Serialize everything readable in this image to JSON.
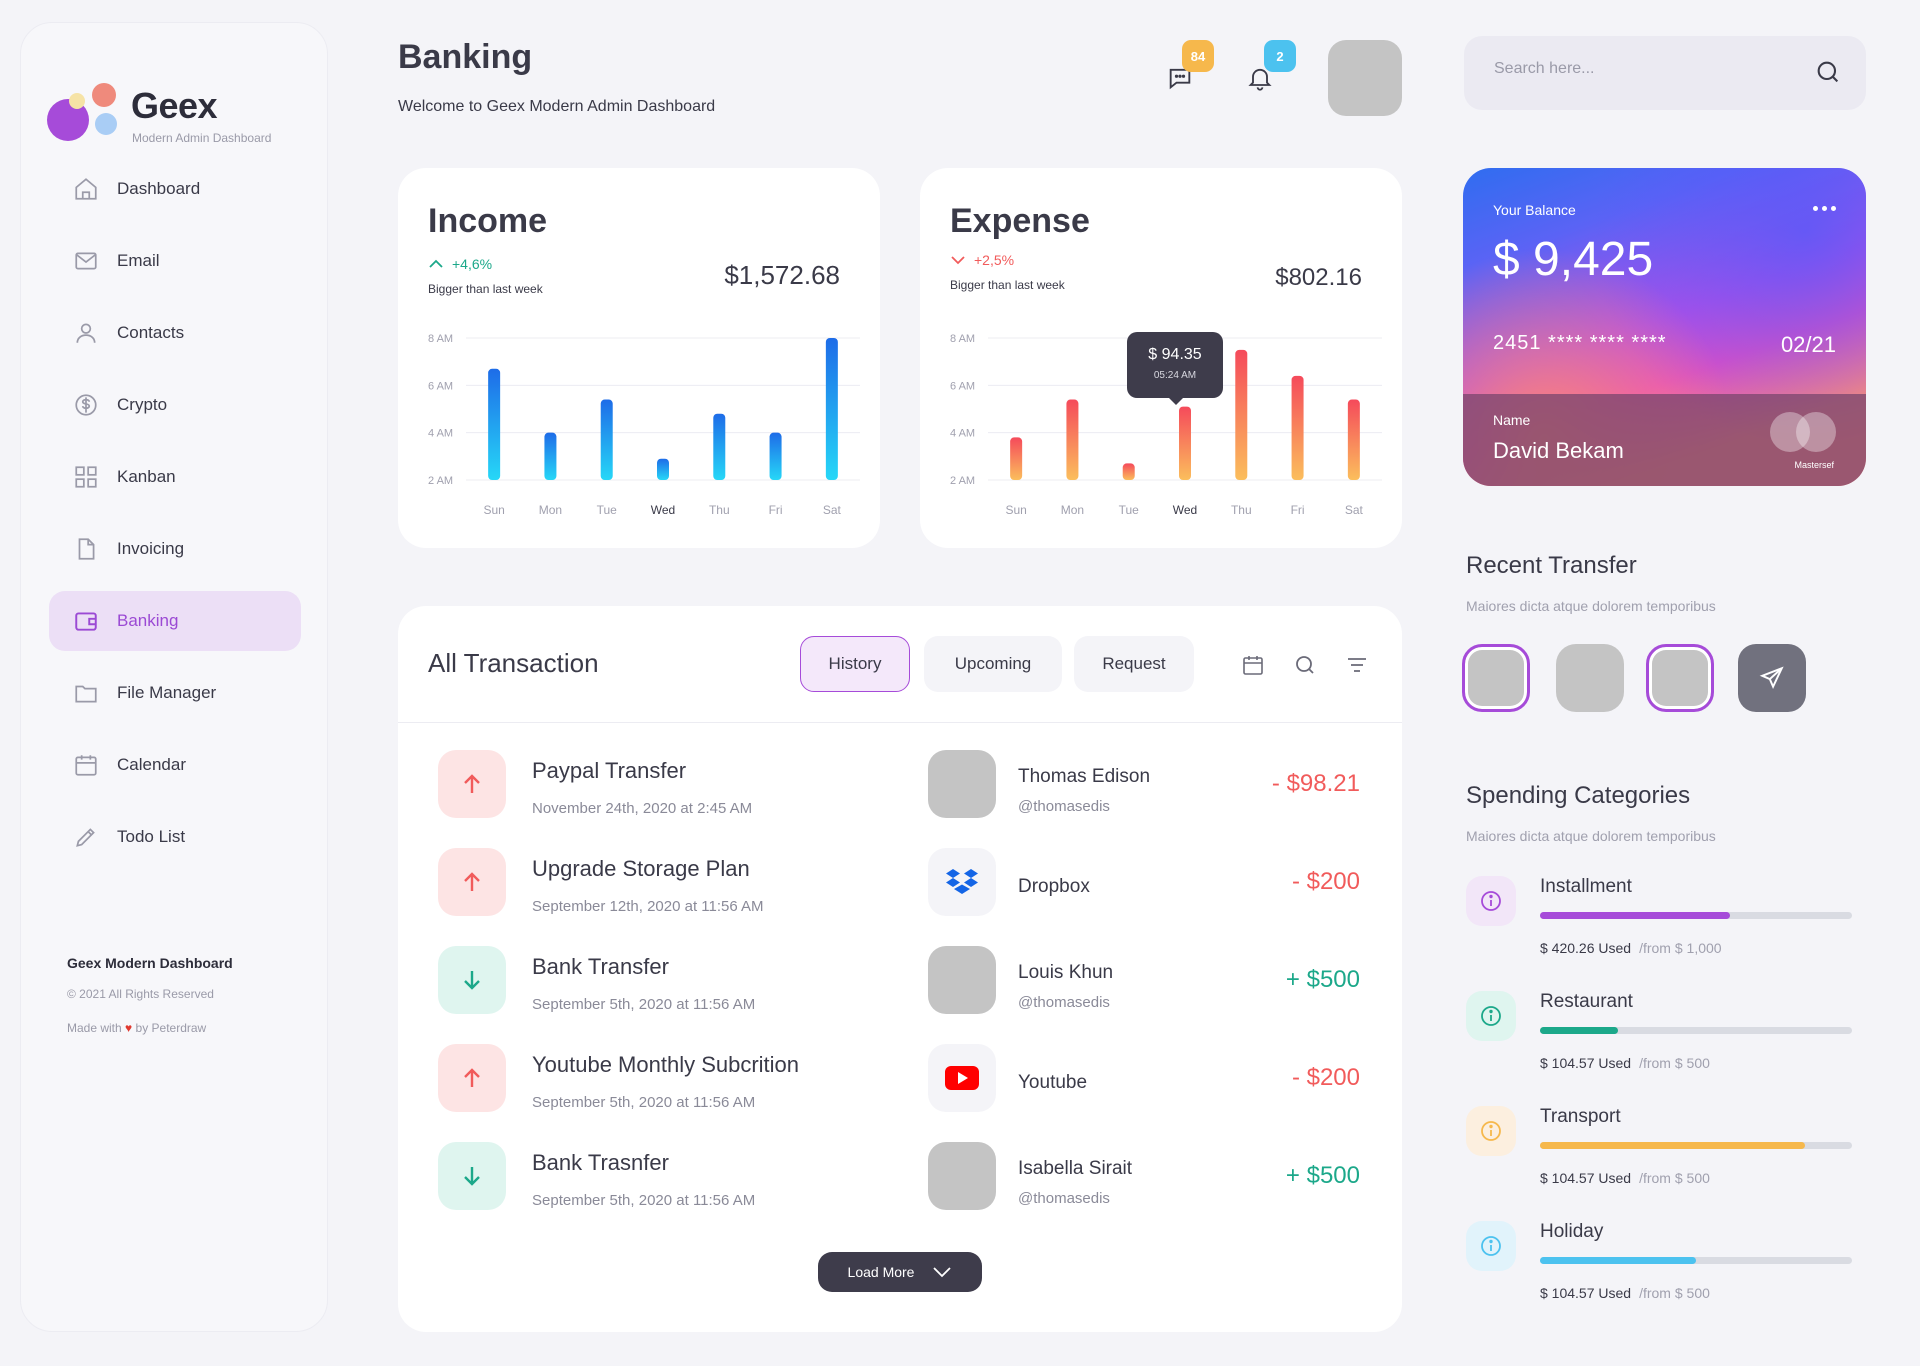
{
  "brand": {
    "name": "Geex",
    "tagline": "Modern Admin Dashboard"
  },
  "sidebar": {
    "items": [
      {
        "label": "Dashboard",
        "icon": "home-icon"
      },
      {
        "label": "Email",
        "icon": "mail-icon"
      },
      {
        "label": "Contacts",
        "icon": "user-icon"
      },
      {
        "label": "Crypto",
        "icon": "dollar-circle-icon"
      },
      {
        "label": "Kanban",
        "icon": "grid-icon"
      },
      {
        "label": "Invoicing",
        "icon": "file-icon"
      },
      {
        "label": "Banking",
        "icon": "wallet-icon",
        "active": true
      },
      {
        "label": "File Manager",
        "icon": "folder-icon"
      },
      {
        "label": "Calendar",
        "icon": "calendar-icon"
      },
      {
        "label": "Todo List",
        "icon": "pencil-icon"
      }
    ],
    "footer": {
      "title": "Geex Modern Dashboard",
      "copyright": "© 2021 All Rights Reserved",
      "made_prefix": "Made with",
      "made_suffix": "by Peterdraw"
    }
  },
  "header": {
    "title": "Banking",
    "subtitle": "Welcome to Geex Modern Admin Dashboard",
    "messages_badge": "84",
    "notifications_badge": "2",
    "search_placeholder": "Search here..."
  },
  "colors": {
    "accent": "#a64bd9",
    "badge_orange": "#f6b84c",
    "badge_blue": "#4cc2ef",
    "negative": "#f15b5b",
    "positive": "#1ca88a"
  },
  "income": {
    "title": "Income",
    "change": "+4,6%",
    "change_sub": "Bigger than last week",
    "amount": "$1,572.68",
    "chart_data": {
      "type": "bar",
      "categories": [
        "Sun",
        "Mon",
        "Tue",
        "Wed",
        "Thu",
        "Fri",
        "Sat"
      ],
      "values": [
        6.7,
        4.0,
        5.4,
        2.9,
        4.8,
        4.0,
        8.0
      ],
      "y_ticks": [
        "2 AM",
        "4 AM",
        "6 AM",
        "8 AM"
      ],
      "ylim": [
        2,
        8
      ],
      "highlight": "Wed"
    }
  },
  "expense": {
    "title": "Expense",
    "change": "+2,5%",
    "change_sub": "Bigger than last week",
    "amount": "$802.16",
    "tooltip": {
      "value": "$ 94.35",
      "time": "05:24 AM"
    },
    "chart_data": {
      "type": "bar",
      "categories": [
        "Sun",
        "Mon",
        "Tue",
        "Wed",
        "Thu",
        "Fri",
        "Sat"
      ],
      "values": [
        3.8,
        5.4,
        2.7,
        5.1,
        7.5,
        6.4,
        5.4
      ],
      "y_ticks": [
        "2 AM",
        "4 AM",
        "6 AM",
        "8 AM"
      ],
      "ylim": [
        2,
        8
      ],
      "highlight": "Wed"
    }
  },
  "transactions": {
    "title": "All Transaction",
    "tabs": [
      "History",
      "Upcoming",
      "Request"
    ],
    "rows": [
      {
        "dir": "up",
        "name": "Paypal Transfer",
        "date": "November 24th, 2020 at 2:45 AM",
        "party": "Thomas Edison",
        "handle": "@thomasedis",
        "amount": "- $98.21",
        "sign": "neg",
        "logo": ""
      },
      {
        "dir": "up",
        "name": "Upgrade Storage Plan",
        "date": "September 12th, 2020 at 11:56 AM",
        "party": "Dropbox",
        "handle": "",
        "amount": "- $200",
        "sign": "neg",
        "logo": "dropbox-icon"
      },
      {
        "dir": "down",
        "name": "Bank Transfer",
        "date": "September 5th, 2020 at 11:56 AM",
        "party": "Louis Khun",
        "handle": "@thomasedis",
        "amount": "+ $500",
        "sign": "pos",
        "logo": ""
      },
      {
        "dir": "up",
        "name": "Youtube Monthly Subcrition",
        "date": "September 5th, 2020 at 11:56 AM",
        "party": "Youtube",
        "handle": "",
        "amount": "- $200",
        "sign": "neg",
        "logo": "youtube-icon"
      },
      {
        "dir": "down",
        "name": "Bank Trasnfer",
        "date": "September 5th, 2020 at 11:56 AM",
        "party": "Isabella Sirait",
        "handle": "@thomasedis",
        "amount": "+ $500",
        "sign": "pos",
        "logo": ""
      }
    ],
    "load_more": "Load More"
  },
  "balance": {
    "label": "Your Balance",
    "value": "$ 9,425",
    "card_number": "2451 **** **** ****",
    "expiry": "02/21",
    "name_label": "Name",
    "name": "David Bekam",
    "brand": "Mastersef"
  },
  "recent_transfer": {
    "title": "Recent Transfer",
    "subtitle": "Maiores dicta atque dolorem temporibus"
  },
  "spending": {
    "title": "Spending Categories",
    "subtitle": "Maiores dicta atque dolorem temporibus",
    "items": [
      {
        "name": "Installment",
        "used": "$ 420.26 Used",
        "from": "/from $ 1,000",
        "progress": 0.61,
        "color": "#a64bd9",
        "bg": "#f2e6f8"
      },
      {
        "name": "Restaurant",
        "used": "$ 104.57 Used",
        "from": "/from $ 500",
        "progress": 0.25,
        "color": "#1ca88a",
        "bg": "#dff5ef"
      },
      {
        "name": "Transport",
        "used": "$ 104.57 Used",
        "from": "/from $ 500",
        "progress": 0.85,
        "color": "#f6b84c",
        "bg": "#fcefdf"
      },
      {
        "name": "Holiday",
        "used": "$ 104.57 Used",
        "from": "/from $ 500",
        "progress": 0.5,
        "color": "#4cc2ef",
        "bg": "#e1f3fb"
      }
    ]
  }
}
